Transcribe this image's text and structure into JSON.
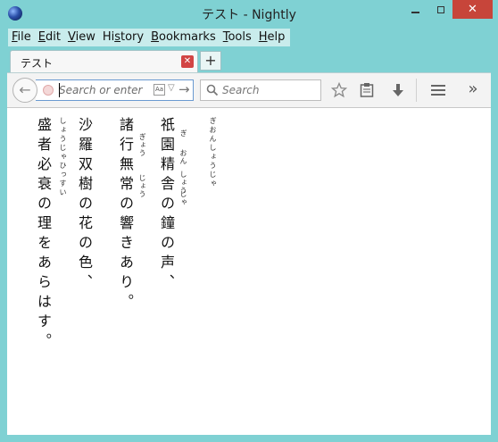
{
  "window": {
    "title": "テスト - Nightly",
    "close_glyph": "✕"
  },
  "menu": [
    {
      "label": "File"
    },
    {
      "label": "Edit"
    },
    {
      "label": "View"
    },
    {
      "label": "History"
    },
    {
      "label": "Bookmarks"
    },
    {
      "label": "Tools"
    },
    {
      "label": "Help"
    }
  ],
  "tab": {
    "title": "テスト",
    "close_glyph": "✕",
    "new_tab_glyph": "+"
  },
  "toolbar": {
    "back_glyph": "←",
    "url_placeholder": "Search or enter",
    "url_ime_glyph": "Aa",
    "url_dropdown_glyph": "▽",
    "url_go_glyph": "→",
    "search_placeholder": "Search",
    "overflow_glyph": "»"
  },
  "content": {
    "lines": [
      {
        "text": "祇園精舎の鐘の声、",
        "ruby": "ぎおんしょうじゃ"
      },
      {
        "text": "諸行無常の響きあり。"
      },
      {
        "text": "沙羅双樹の花の色、",
        "ruby": "しょうじゃひっすい"
      },
      {
        "text": "盛者必衰の理をあらはす。"
      }
    ],
    "inline_ruby": [
      {
        "text": "ぎ"
      },
      {
        "text": "おん"
      },
      {
        "text": "しょう"
      },
      {
        "text": "じゃ"
      },
      {
        "text": "ぎょう"
      },
      {
        "text": "じょう"
      }
    ]
  },
  "colors": {
    "frame": "#7fd1d3",
    "close_button": "#c7453a",
    "url_border": "#6a9ad1"
  }
}
